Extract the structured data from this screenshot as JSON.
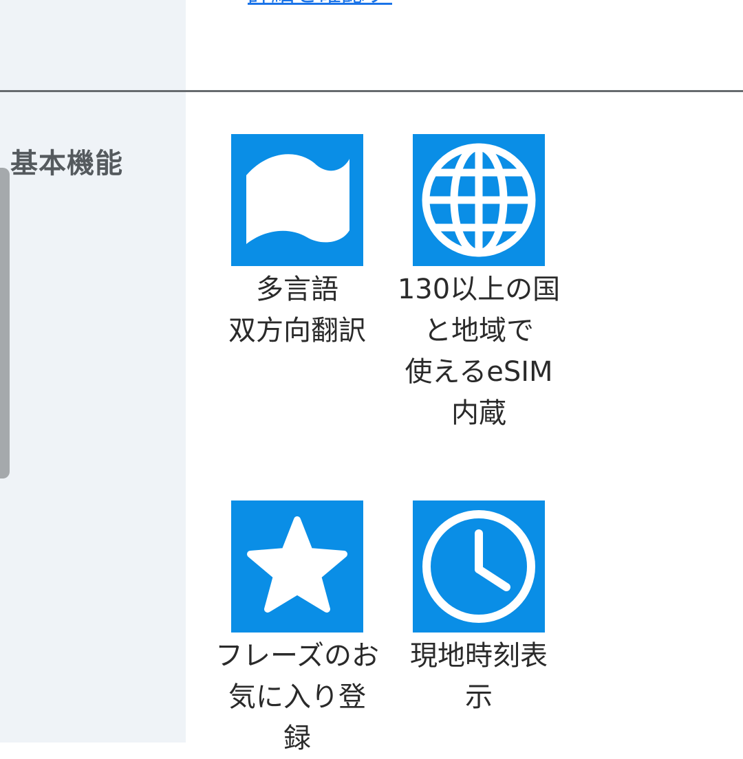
{
  "top_link": {
    "text": "詳細を確認する"
  },
  "section": {
    "heading": "基本機能"
  },
  "features": [
    {
      "icon": "flag-icon",
      "label_lines": [
        "多言語",
        "双方向翻訳"
      ]
    },
    {
      "icon": "globe-icon",
      "label_lines": [
        "130以上の国",
        "と地域で",
        "使えるeSIM",
        "内蔵"
      ]
    },
    {
      "icon": "star-icon",
      "label_lines": [
        "フレーズのお",
        "気に入り登",
        "録"
      ]
    },
    {
      "icon": "clock-icon",
      "label_lines": [
        "現地時刻表",
        "示"
      ]
    }
  ],
  "colors": {
    "icon_background": "#0a8ee6",
    "sidebar_background": "#eff3f7",
    "heading_text": "#555a5e",
    "link": "#1a73e8"
  }
}
